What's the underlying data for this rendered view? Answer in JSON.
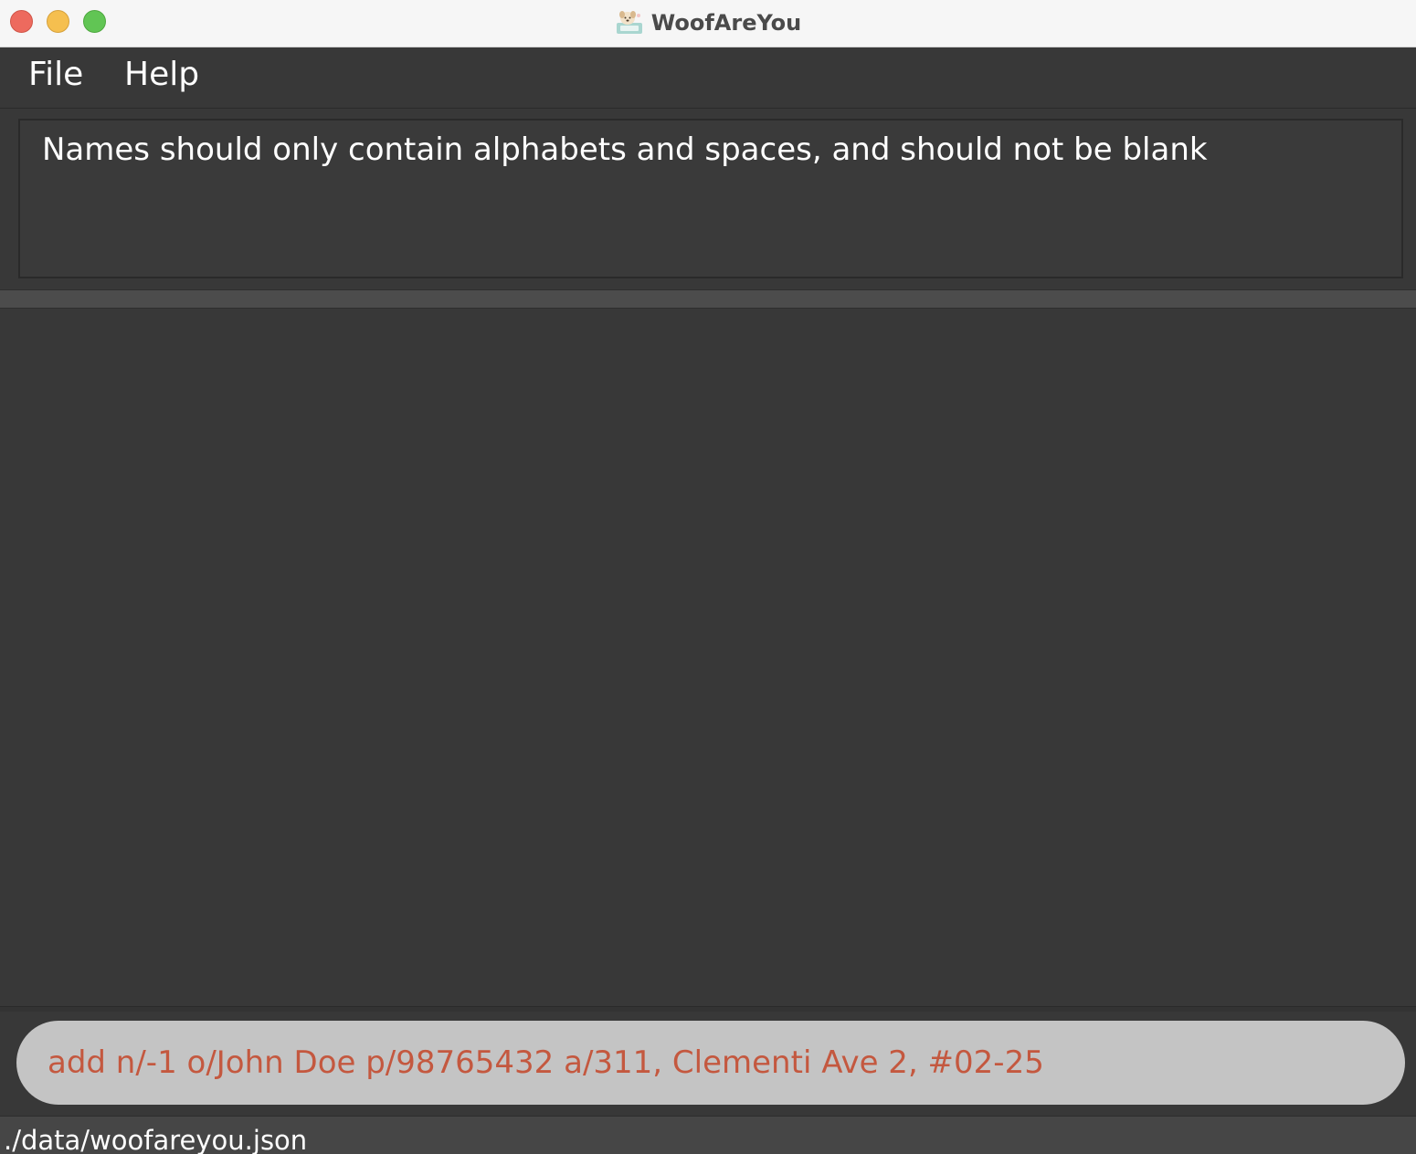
{
  "window": {
    "title": "WoofAreYou",
    "app_icon": "dog-app-icon"
  },
  "menu": {
    "items": [
      {
        "label": "File"
      },
      {
        "label": "Help"
      }
    ]
  },
  "result_display": {
    "message": "Names should only contain alphabets and spaces, and should not be blank"
  },
  "command_box": {
    "value": "add n/-1 o/John Doe p/98765432 a/311, Clementi Ave 2, #02-25",
    "text_color": "#c4583f"
  },
  "status_bar": {
    "file_path": "./data/woofareyou.json"
  }
}
